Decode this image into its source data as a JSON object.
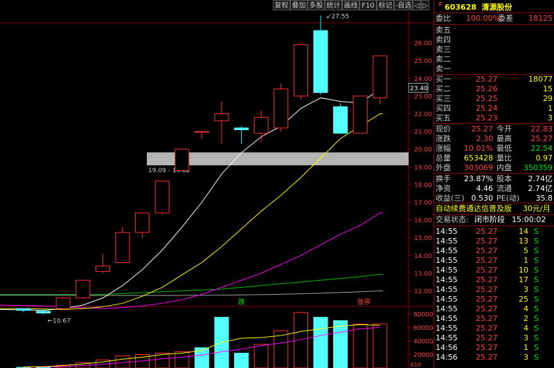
{
  "toolbar": {
    "buttons": [
      "复权",
      "叠加",
      "多股",
      "统计",
      "画线",
      "F10",
      "标记",
      "-自选",
      "◁",
      "▷"
    ]
  },
  "stock": {
    "code": "603628",
    "name": "清源股份",
    "r_mark": "R",
    "weibi_label": "委比",
    "weibi_value": "100.00%",
    "weicha_label": "委差",
    "weicha_value": "18125",
    "sell_levels": [
      {
        "label": "卖五"
      },
      {
        "label": "卖四"
      },
      {
        "label": "卖三"
      },
      {
        "label": "卖二"
      },
      {
        "label": "卖一"
      }
    ],
    "buy_levels": [
      {
        "label": "买一",
        "price": "25.27",
        "vol": "18077"
      },
      {
        "label": "买二",
        "price": "25.26",
        "vol": "15"
      },
      {
        "label": "买三",
        "price": "25.25",
        "vol": "29"
      },
      {
        "label": "买四",
        "price": "25.24",
        "vol": "1"
      },
      {
        "label": "买五",
        "price": "25.23",
        "vol": "3"
      }
    ],
    "quote": [
      {
        "l1": "现价",
        "v1": "25.27",
        "l2": "今开",
        "v2": "22.83"
      },
      {
        "l1": "涨跌",
        "v1": "2.30",
        "l2": "最高",
        "v2": "25.27"
      },
      {
        "l1": "涨幅",
        "v1": "10.01%",
        "l2": "最低",
        "v2": "22.54"
      },
      {
        "l1": "总量",
        "v1": "653428",
        "l2": "量比",
        "v2": "0.97"
      },
      {
        "l1": "外盘",
        "v1": "303069",
        "l2": "内盘",
        "v2": "350359"
      }
    ],
    "fund": [
      {
        "l1": "换手",
        "v1": "23.87%",
        "l2": "股本",
        "v2": "2.74亿"
      },
      {
        "l1": "净资",
        "v1": "4.46",
        "l2": "流通",
        "v2": "2.74亿"
      },
      {
        "l1": "收益(三)",
        "v1": "0.530",
        "l2": "PE(动)",
        "v2": "35.8"
      }
    ],
    "promo": "自动续费通达信普及版",
    "promo_price": "30元/月",
    "status_label": "交易状态:",
    "status_value": "闭市阶段",
    "status_time": "15:00:02"
  },
  "ticks": [
    {
      "t": "14:55",
      "p": "25.27",
      "v": "14",
      "s": "S"
    },
    {
      "t": "14:55",
      "p": "25.27",
      "v": "13",
      "s": "S"
    },
    {
      "t": "14:55",
      "p": "25.27",
      "v": "5",
      "s": "S"
    },
    {
      "t": "14:55",
      "p": "25.27",
      "v": "1",
      "s": "S"
    },
    {
      "t": "14:55",
      "p": "25.27",
      "v": "10",
      "s": "S"
    },
    {
      "t": "14:55",
      "p": "25.27",
      "v": "17",
      "s": "S"
    },
    {
      "t": "14:55",
      "p": "25.27",
      "v": "3",
      "s": "S"
    },
    {
      "t": "14:55",
      "p": "25.27",
      "v": "25",
      "s": "S"
    },
    {
      "t": "14:55",
      "p": "25.27",
      "v": "4",
      "s": "S"
    },
    {
      "t": "14:55",
      "p": "25.27",
      "v": "2",
      "s": "S"
    },
    {
      "t": "14:55",
      "p": "25.27",
      "v": "4",
      "s": "S"
    },
    {
      "t": "14:55",
      "p": "25.27",
      "v": "3",
      "s": "S"
    },
    {
      "t": "14:56",
      "p": "25.27",
      "v": "1",
      "s": "S"
    },
    {
      "t": "14:56",
      "p": "25.27",
      "v": "3",
      "s": "S"
    }
  ],
  "chart_data": {
    "type": "candlestick",
    "price_axis": [
      "26.00",
      "25.00",
      "24.00",
      "23.00",
      "22.00",
      "21.00",
      "20.00",
      "19.00",
      "18.00",
      "17.00",
      "16.00",
      "15.00",
      "14.00",
      "13.00",
      "12.00"
    ],
    "ylim": [
      11.2,
      27.8
    ],
    "price_readout": "23.40",
    "max_label": "27.55",
    "min_label": "10.67",
    "gap_label": "19.09 - 19.82",
    "gap_range": [
      19.09,
      19.82
    ],
    "candles": [
      {
        "o": 11.0,
        "h": 11.0,
        "l": 10.8,
        "c": 10.9
      },
      {
        "o": 10.85,
        "h": 11.0,
        "l": 10.67,
        "c": 10.75
      },
      {
        "o": 11.0,
        "h": 11.65,
        "l": 10.9,
        "c": 11.6
      },
      {
        "o": 11.6,
        "h": 12.6,
        "l": 11.55,
        "c": 12.6
      },
      {
        "o": 13.1,
        "h": 14.1,
        "l": 13.0,
        "c": 13.4
      },
      {
        "o": 13.6,
        "h": 15.6,
        "l": 13.6,
        "c": 15.3
      },
      {
        "o": 15.3,
        "h": 16.4,
        "l": 15.0,
        "c": 16.4
      },
      {
        "o": 16.4,
        "h": 18.2,
        "l": 16.3,
        "c": 18.2
      },
      {
        "o": 18.8,
        "h": 20.0,
        "l": 18.8,
        "c": 20.0
      },
      {
        "o": 21.0,
        "h": 21.0,
        "l": 20.6,
        "c": 21.0
      },
      {
        "o": 21.6,
        "h": 22.7,
        "l": 20.3,
        "c": 22.0
      },
      {
        "o": 21.2,
        "h": 21.3,
        "l": 20.3,
        "c": 21.1
      },
      {
        "o": 20.9,
        "h": 22.2,
        "l": 20.4,
        "c": 21.8
      },
      {
        "o": 21.2,
        "h": 23.7,
        "l": 21.0,
        "c": 23.4
      },
      {
        "o": 23.0,
        "h": 25.9,
        "l": 22.8,
        "c": 25.9
      },
      {
        "o": 26.7,
        "h": 27.55,
        "l": 23.1,
        "c": 23.2
      },
      {
        "o": 22.4,
        "h": 22.6,
        "l": 20.9,
        "c": 20.9
      },
      {
        "o": 20.9,
        "h": 23.0,
        "l": 20.9,
        "c": 23.0
      },
      {
        "o": 22.9,
        "h": 25.27,
        "l": 22.54,
        "c": 25.27
      }
    ],
    "ma5": [
      10.95,
      10.9,
      11.0,
      11.2,
      11.6,
      12.3,
      13.2,
      14.3,
      15.6,
      17.0,
      18.6,
      19.8,
      20.7,
      21.3,
      22.3,
      22.9,
      22.7,
      22.6,
      23.4
    ],
    "ma10": [
      11.0,
      10.98,
      10.95,
      11.0,
      11.1,
      11.3,
      11.7,
      12.2,
      12.9,
      13.6,
      14.5,
      15.5,
      16.5,
      17.4,
      18.4,
      19.5,
      20.6,
      21.3,
      22.0
    ],
    "ma20": [
      11.2,
      11.15,
      11.1,
      11.05,
      11.0,
      11.05,
      11.15,
      11.3,
      11.5,
      11.8,
      12.2,
      12.6,
      13.0,
      13.5,
      14.0,
      14.6,
      15.2,
      15.7,
      16.4
    ],
    "ma60": [
      11.8,
      11.8,
      11.8,
      11.8,
      11.8,
      11.85,
      11.9,
      11.95,
      12.0,
      12.05,
      12.1,
      12.2,
      12.3,
      12.4,
      12.5,
      12.6,
      12.7,
      12.8,
      12.95
    ],
    "ma120": [
      11.75,
      11.75,
      11.75,
      11.74,
      11.74,
      11.74,
      11.74,
      11.74,
      11.75,
      11.75,
      11.76,
      11.77,
      11.79,
      11.81,
      11.84,
      11.87,
      11.91,
      11.95,
      12.0
    ],
    "volume_axis": [
      "80000",
      "60000",
      "40000",
      "20000"
    ],
    "volume_unit": "X10",
    "volume_ylim": [
      0,
      90000
    ],
    "volumes": [
      1000,
      2000,
      4000,
      8000,
      12000,
      18000,
      20000,
      22000,
      24000,
      30000,
      75000,
      22000,
      35000,
      55000,
      82000,
      75000,
      70000,
      65000,
      65300
    ],
    "volume_up": [
      false,
      false,
      true,
      true,
      true,
      true,
      true,
      true,
      true,
      false,
      false,
      false,
      true,
      true,
      true,
      false,
      false,
      true,
      true
    ],
    "markers": [
      {
        "bar": 11,
        "text": "跌",
        "color": "#00e600"
      },
      {
        "bar": 17,
        "text": "涨停",
        "color": "#ff4040"
      }
    ]
  }
}
